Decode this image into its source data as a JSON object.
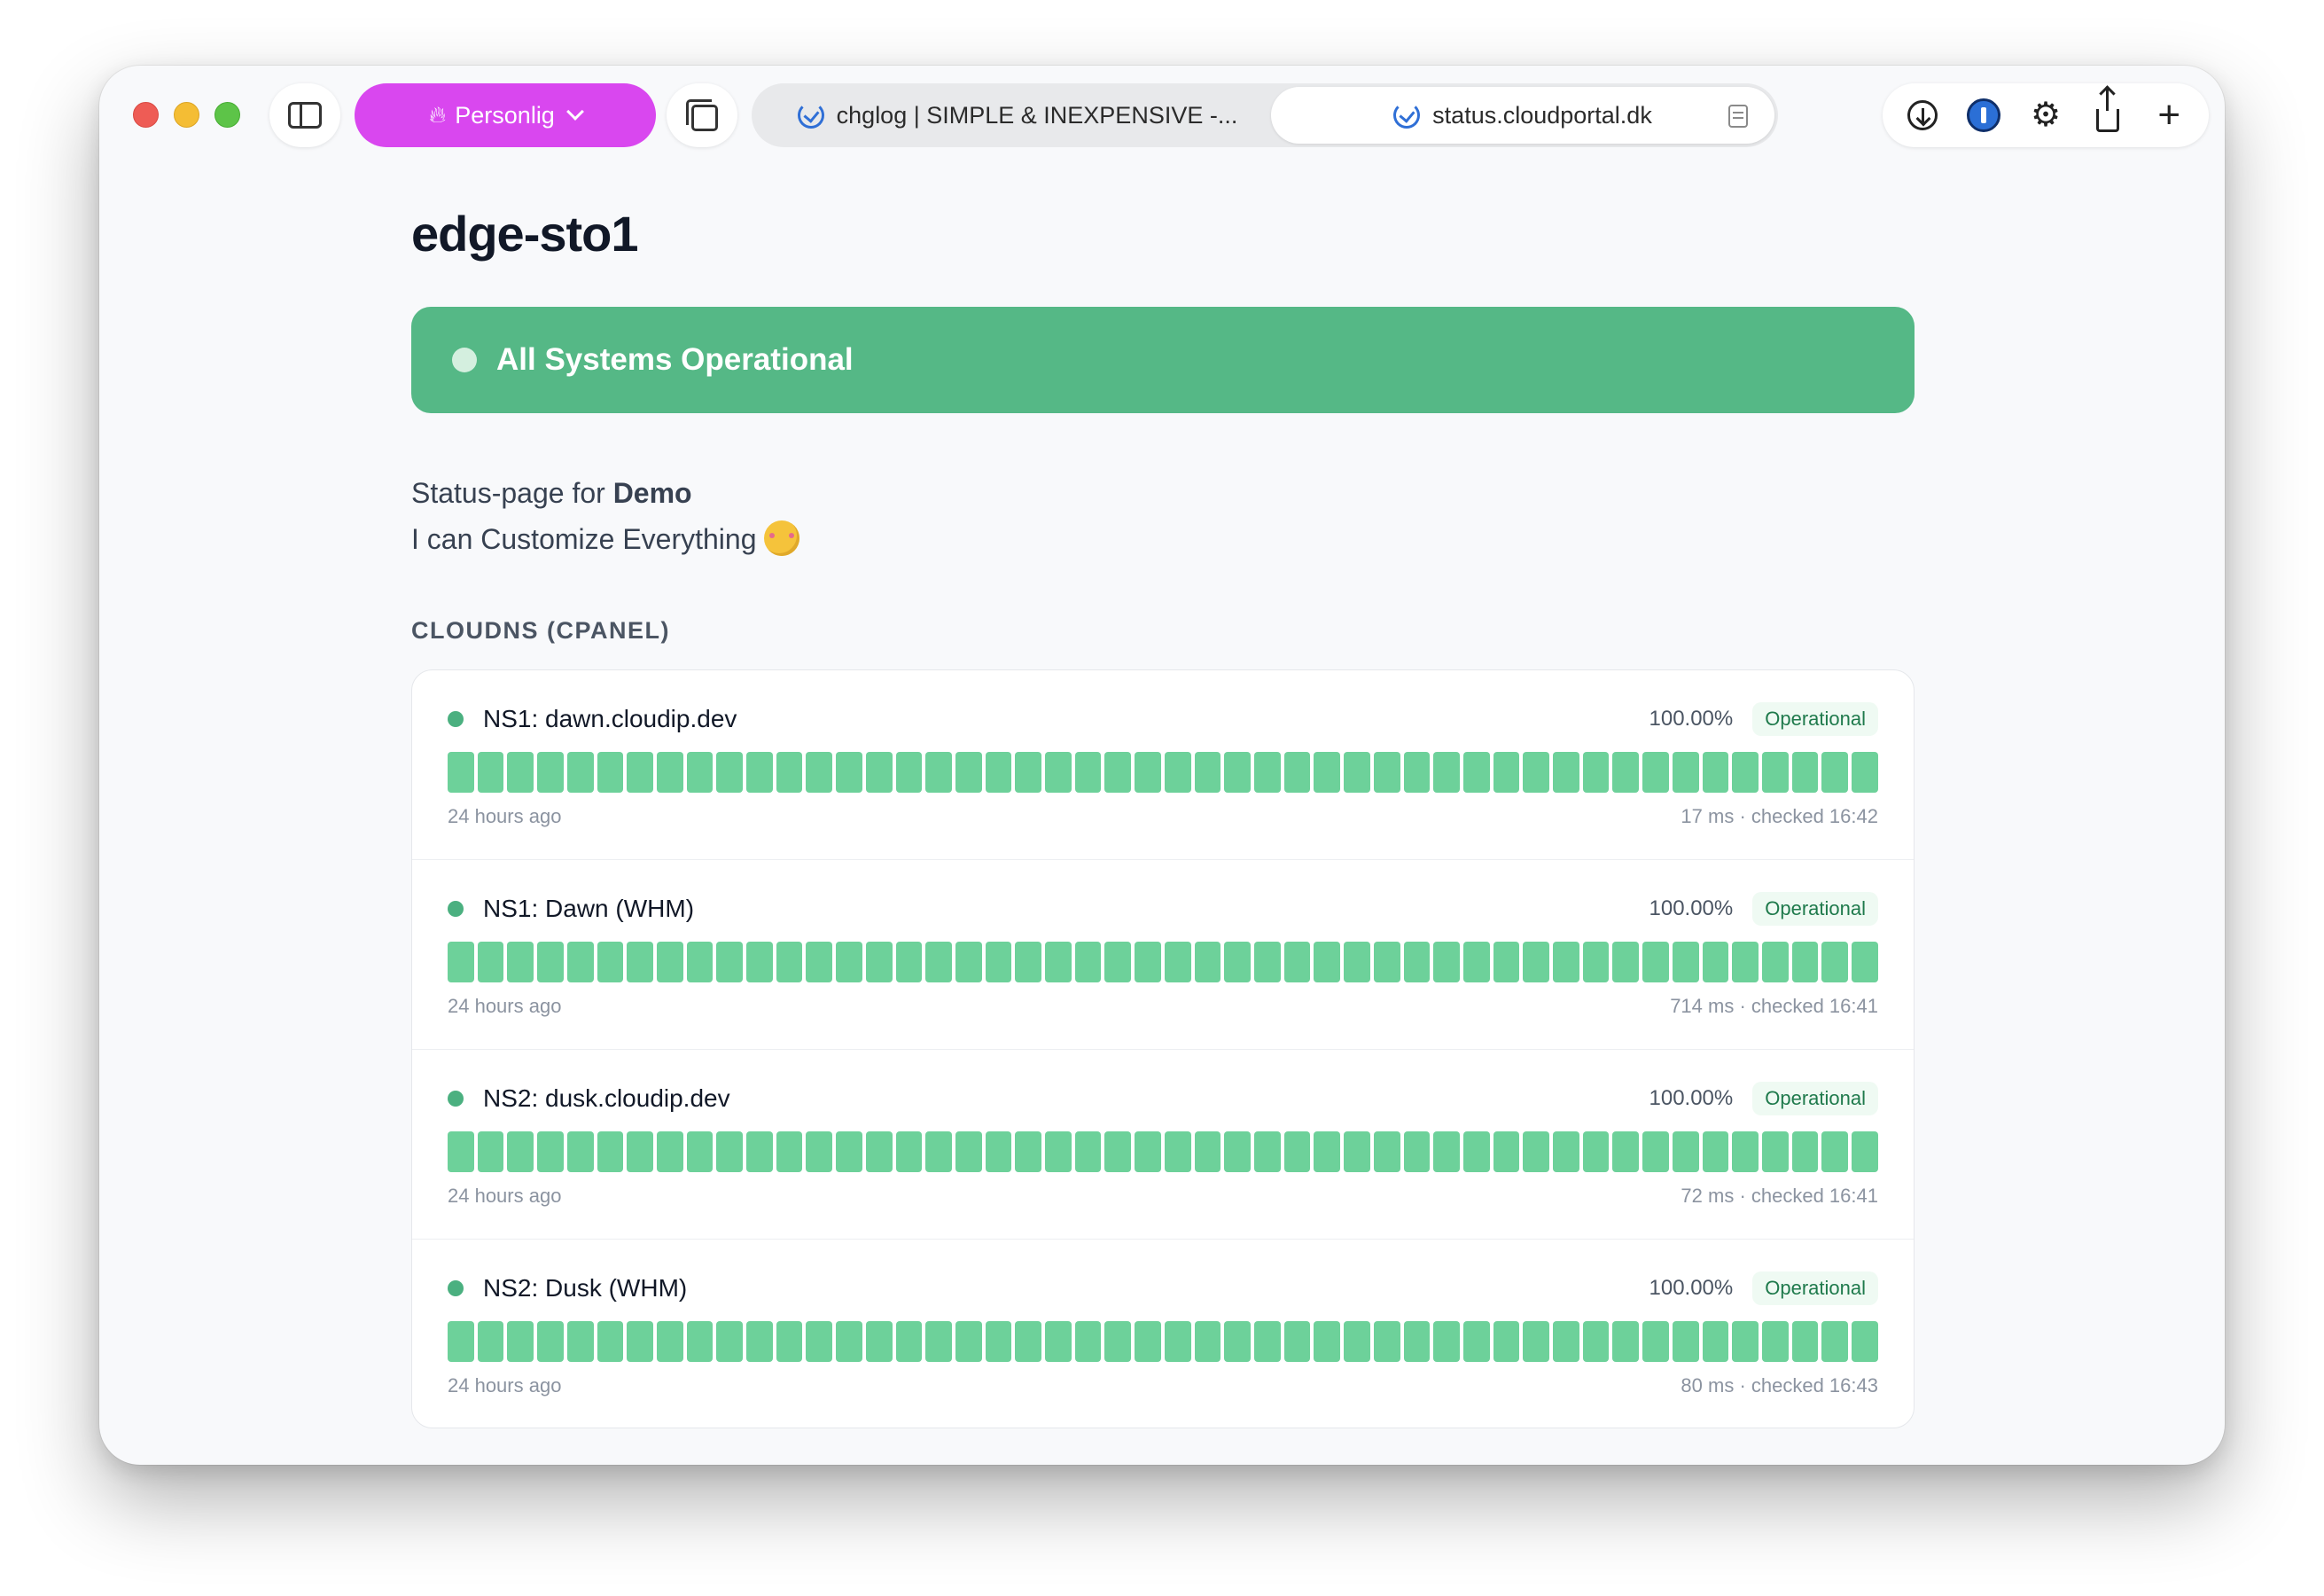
{
  "browser": {
    "profile_label": "Personlig",
    "tabs": [
      {
        "title": "chglog | SIMPLE & INEXPENSIVE -..."
      },
      {
        "title": "status.cloudportal.dk"
      }
    ]
  },
  "page": {
    "title": "edge-sto1",
    "banner": {
      "text": "All Systems Operational",
      "color": "#55b886"
    },
    "description": {
      "line1_prefix": "Status-page for ",
      "line1_bold": "Demo",
      "line2": "I can Customize Everything"
    },
    "section": {
      "title": "CLOUDNS (CPANEL)",
      "monitors": [
        {
          "name": "NS1: dawn.cloudip.dev",
          "uptime": "100.00%",
          "status": "Operational",
          "left": "24 hours ago",
          "right": "17 ms · checked 16:42",
          "bars": 48,
          "bar_color": "#6dd19a"
        },
        {
          "name": "NS1: Dawn (WHM)",
          "uptime": "100.00%",
          "status": "Operational",
          "left": "24 hours ago",
          "right": "714 ms · checked 16:41",
          "bars": 48,
          "bar_color": "#6dd19a"
        },
        {
          "name": "NS2: dusk.cloudip.dev",
          "uptime": "100.00%",
          "status": "Operational",
          "left": "24 hours ago",
          "right": "72 ms · checked 16:41",
          "bars": 48,
          "bar_color": "#6dd19a"
        },
        {
          "name": "NS2: Dusk (WHM)",
          "uptime": "100.00%",
          "status": "Operational",
          "left": "24 hours ago",
          "right": "80 ms · checked 16:43",
          "bars": 48,
          "bar_color": "#6dd19a"
        }
      ]
    }
  },
  "icons": {
    "sidebar": "sidebar-icon",
    "flame": "flame-icon",
    "tabs_overview": "tabs-overview-icon",
    "favicon": "status-check-icon",
    "reader": "reader-icon",
    "download": "download-icon",
    "password_manager": "password-manager-icon",
    "settings": "gear-icon",
    "share": "share-icon",
    "new_tab": "plus-icon"
  }
}
